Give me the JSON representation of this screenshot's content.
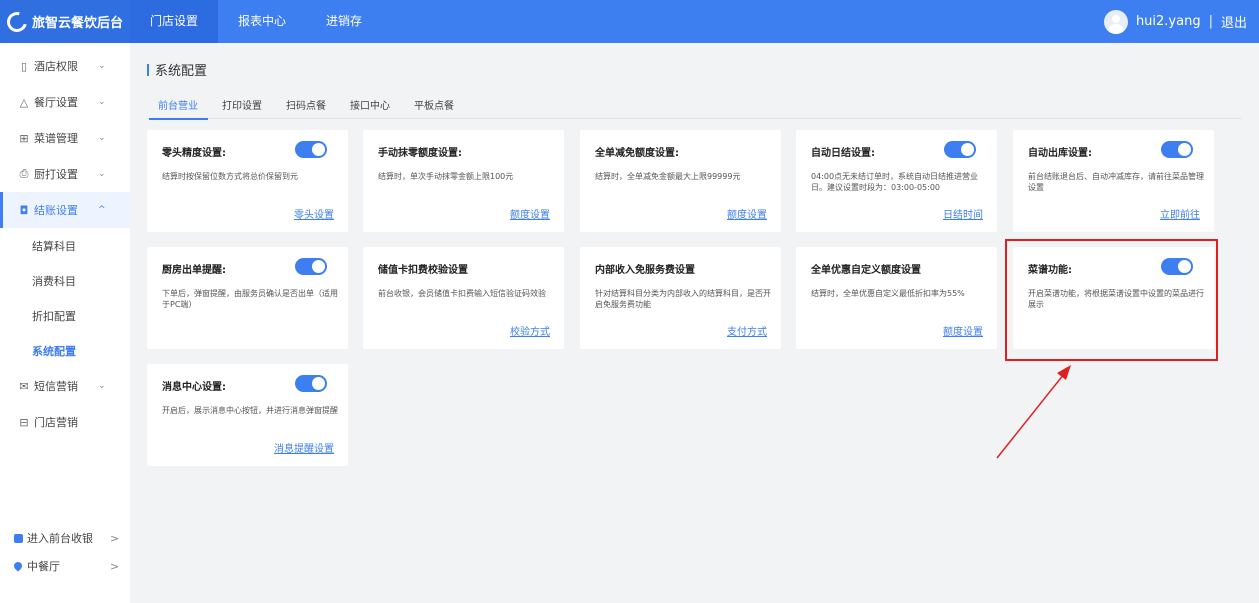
{
  "brand": {
    "title": "旅智云餐饮后台"
  },
  "nav": [
    {
      "label": "门店设置"
    },
    {
      "label": "报表中心"
    },
    {
      "label": "进销存"
    }
  ],
  "user": {
    "name": "hui2.yang",
    "separator": "|",
    "logout": "退出"
  },
  "sidebar": {
    "items": [
      {
        "label": "酒店权限",
        "icon": "hotel-icon"
      },
      {
        "label": "餐厅设置",
        "icon": "bell-icon"
      },
      {
        "label": "菜谱管理",
        "icon": "grid-icon"
      },
      {
        "label": "厨打设置",
        "icon": "printer-icon"
      },
      {
        "label": "结账设置",
        "icon": "checkout-icon"
      }
    ],
    "sub_items": [
      {
        "label": "结算科目"
      },
      {
        "label": "消费科目"
      },
      {
        "label": "折扣配置"
      },
      {
        "label": "系统配置"
      }
    ],
    "items2": [
      {
        "label": "短信营销",
        "icon": "mail-icon"
      },
      {
        "label": "门店营销",
        "icon": "gift-icon"
      }
    ],
    "bottom": [
      {
        "label": "进入前台收银",
        "arrow": ">"
      },
      {
        "label": "中餐厅",
        "arrow": ">"
      }
    ],
    "chevron_down": "⌄",
    "chevron_up": "^"
  },
  "page": {
    "title": "系统配置"
  },
  "tabs": [
    {
      "label": "前台营业"
    },
    {
      "label": "打印设置"
    },
    {
      "label": "扫码点餐"
    },
    {
      "label": "接口中心"
    },
    {
      "label": "平板点餐"
    }
  ],
  "cards": [
    {
      "title": "零头精度设置:",
      "desc": "结算时按保留位数方式将总价保留到元",
      "link": "零头设置",
      "toggle": true
    },
    {
      "title": "手动抹零额度设置:",
      "desc": "结算时，单次手动抹零金额上限100元",
      "link": "额度设置",
      "toggle": false
    },
    {
      "title": "全单减免额度设置:",
      "desc": "结算时，全单减免金额最大上限99999元",
      "link": "额度设置",
      "toggle": false
    },
    {
      "title": "自动日结设置:",
      "desc": "04:00点无未结订单时，系统自动日结推进营业日。建议设置时段为：03:00-05:00",
      "link": "日结时间",
      "toggle": true
    },
    {
      "title": "自动出库设置:",
      "desc": "前台结账退台后、自动冲减库存，请前往菜品管理设置",
      "link": "立即前往",
      "toggle": true
    },
    {
      "title": "厨房出单提醒:",
      "desc": "下单后，弹窗提醒，由服务员确认是否出单（适用于PC端）",
      "link": "",
      "toggle": true
    },
    {
      "title": "储值卡扣费校验设置",
      "desc": "前台收银，会员储值卡扣费输入短信验证码效验",
      "link": "校验方式",
      "toggle": false
    },
    {
      "title": "内部收入免服务费设置",
      "desc": "针对结算科目分类为内部收入的结算科目，是否开启免服务费功能",
      "link": "支付方式",
      "toggle": false
    },
    {
      "title": "全单优惠自定义额度设置",
      "desc": "结算时，全单优惠自定义最低折扣率为55%",
      "link": "额度设置",
      "toggle": false
    },
    {
      "title": "菜谱功能:",
      "desc": "开启菜谱功能，将根据菜谱设置中设置的菜品进行展示",
      "link": "",
      "toggle": true
    },
    {
      "title": "消息中心设置:",
      "desc": "开启后，展示消息中心按钮，并进行消息弹窗提醒",
      "link": "消息提醒设置",
      "toggle": true
    }
  ],
  "colors": {
    "primary": "#3d7ef0",
    "annotation": "#e02020"
  }
}
